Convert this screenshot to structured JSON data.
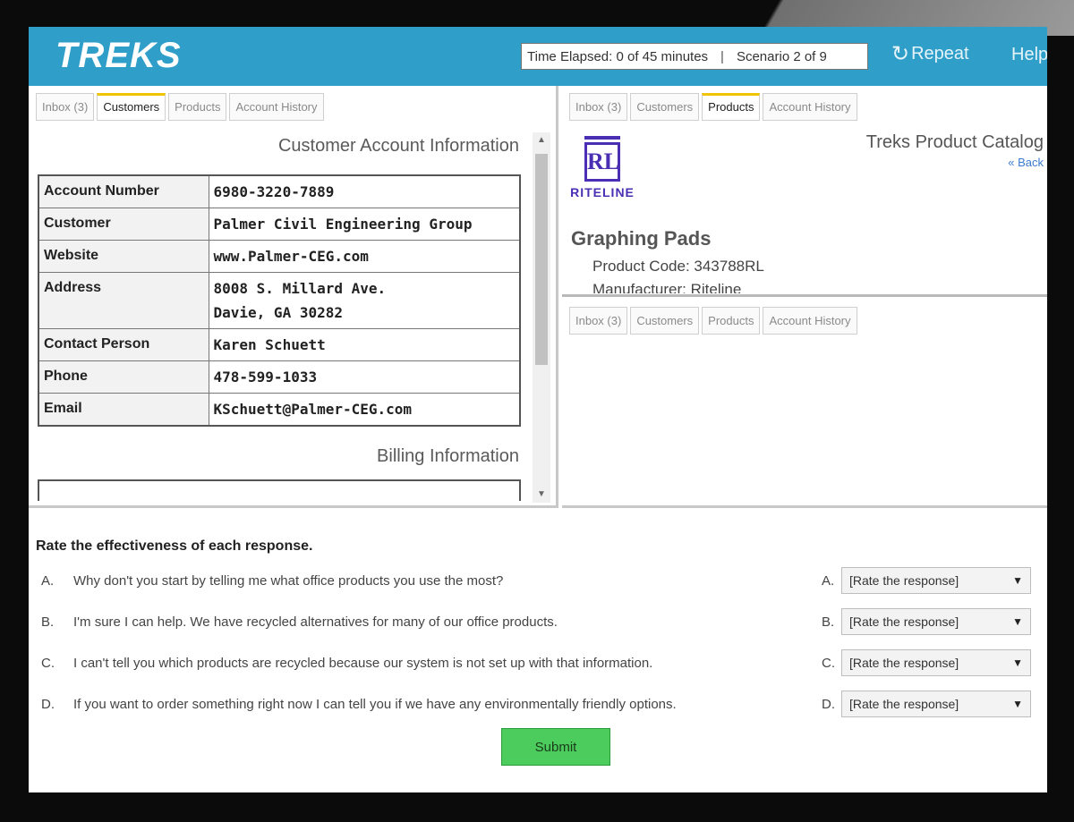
{
  "header": {
    "logo": "TREKS",
    "time_elapsed": "Time Elapsed: 0 of 45 minutes",
    "scenario": "Scenario 2 of 9",
    "repeat_label": "Repeat",
    "help_label": "Help"
  },
  "tabs": [
    "Inbox (3)",
    "Customers",
    "Products",
    "Account History"
  ],
  "left_pane": {
    "active_tab": "Customers",
    "section_title": "Customer Account Information",
    "rows": [
      {
        "label": "Account Number",
        "value": "6980-3220-7889"
      },
      {
        "label": "Customer",
        "value": "Palmer Civil Engineering Group"
      },
      {
        "label": "Website",
        "value": "www.Palmer-CEG.com"
      },
      {
        "label": "Address",
        "value": "8008 S. Millard Ave.",
        "value2": "Davie, GA 30282"
      },
      {
        "label": "Contact Person",
        "value": "Karen Schuett"
      },
      {
        "label": "Phone",
        "value": "478-599-1033"
      },
      {
        "label": "Email",
        "value": "KSchuett@Palmer-CEG.com"
      }
    ],
    "billing_title": "Billing Information"
  },
  "right_top_pane": {
    "active_tab": "Products",
    "catalog_title": "Treks Product Catalog",
    "back_link": "« Back",
    "logo_letters": "RL",
    "logo_name": "RITELINE",
    "product_name": "Graphing Pads",
    "product_code": "Product Code: 343788RL",
    "manufacturer": "Manufacturer: Riteline"
  },
  "question": {
    "title": "Rate the effectiveness of each response.",
    "select_placeholder": "[Rate the response]",
    "items": [
      {
        "letter": "A.",
        "text": "Why don't you start by telling me what office products you use the most?"
      },
      {
        "letter": "B.",
        "text": "I'm sure I can help. We have recycled alternatives for many of our office products."
      },
      {
        "letter": "C.",
        "text": "I can't tell you which products are recycled because our system is not set up with that information."
      },
      {
        "letter": "D.",
        "text": "If you want to order something right now I can tell you if we have any environmentally friendly options."
      }
    ],
    "submit_label": "Submit"
  },
  "colors": {
    "header": "#2f9fc9",
    "active_tab_accent": "#f0c400",
    "submit": "#4ccc5c",
    "logo_purple": "#4a2fb5"
  }
}
